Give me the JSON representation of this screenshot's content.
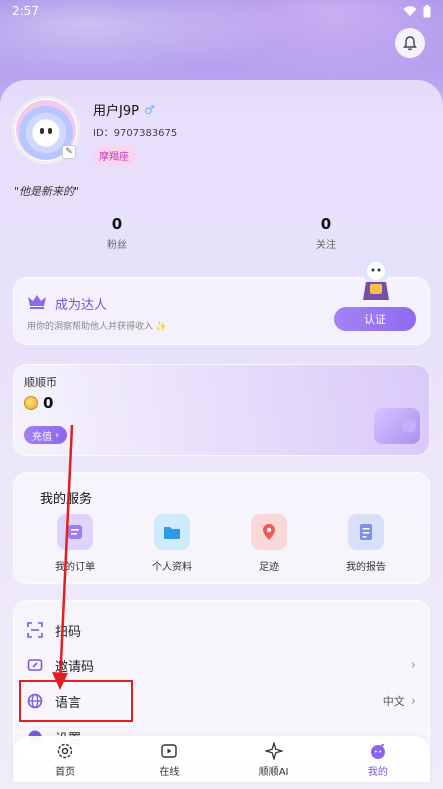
{
  "status": {
    "time": "2:57"
  },
  "profile": {
    "username": "用户J9P",
    "gender_symbol": "♂",
    "user_id": "ID：9707383675",
    "zodiac": "摩羯座",
    "bio": "\"他是新来的\""
  },
  "stats": [
    {
      "value": "0",
      "label": "粉丝"
    },
    {
      "value": "0",
      "label": "关注"
    }
  ],
  "expert": {
    "title": "成为达人",
    "subtitle": "用你的洞察帮助他人并获得收入",
    "button": "认证"
  },
  "coins": {
    "title": "顺顺币",
    "amount": "0",
    "recharge": "充值"
  },
  "services": {
    "title": "我的服务",
    "items": [
      {
        "label": "我的订单",
        "icon": "order-icon"
      },
      {
        "label": "个人资料",
        "icon": "folder-icon"
      },
      {
        "label": "足迹",
        "icon": "location-pin-icon"
      },
      {
        "label": "我的报告",
        "icon": "report-icon"
      }
    ]
  },
  "menu": {
    "scan": "扫码",
    "invite": "邀请码",
    "language": "语言",
    "language_value": "中文",
    "settings": "设置"
  },
  "tabs": [
    {
      "label": "首页",
      "icon": "gear-flower-icon"
    },
    {
      "label": "在线",
      "icon": "play-icon"
    },
    {
      "label": "顺顺AI",
      "icon": "sparkle-icon"
    },
    {
      "label": "我的",
      "icon": "mine-icon"
    }
  ],
  "colors": {
    "accent": "#8a63ee",
    "annotation": "#e02020"
  }
}
